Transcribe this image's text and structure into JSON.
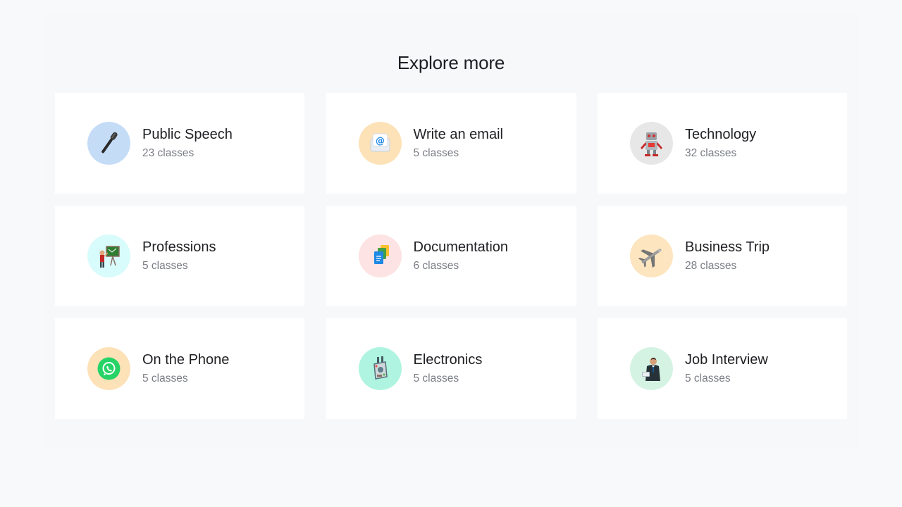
{
  "section": {
    "title": "Explore more"
  },
  "cards": [
    {
      "title": "Public Speech",
      "subtitle": "23 classes",
      "icon": "microphone-icon",
      "circle_color": "#c5dcf7"
    },
    {
      "title": "Write an email",
      "subtitle": "5 classes",
      "icon": "email-icon",
      "circle_color": "#fde2b8"
    },
    {
      "title": "Technology",
      "subtitle": "32 classes",
      "icon": "robot-icon",
      "circle_color": "#e7e7e7"
    },
    {
      "title": "Professions",
      "subtitle": "5 classes",
      "icon": "teacher-icon",
      "circle_color": "#d8fbfb"
    },
    {
      "title": "Documentation",
      "subtitle": "6 classes",
      "icon": "documents-icon",
      "circle_color": "#fde3e3"
    },
    {
      "title": "Business Trip",
      "subtitle": "28 classes",
      "icon": "airplane-icon",
      "circle_color": "#fde5bf"
    },
    {
      "title": "On the Phone",
      "subtitle": "5 classes",
      "icon": "whatsapp-icon",
      "circle_color": "#fde2b8"
    },
    {
      "title": "Electronics",
      "subtitle": "5 classes",
      "icon": "gadget-icon",
      "circle_color": "#aef4e0"
    },
    {
      "title": "Job Interview",
      "subtitle": "5 classes",
      "icon": "businessman-icon",
      "circle_color": "#d5f3e3"
    }
  ]
}
